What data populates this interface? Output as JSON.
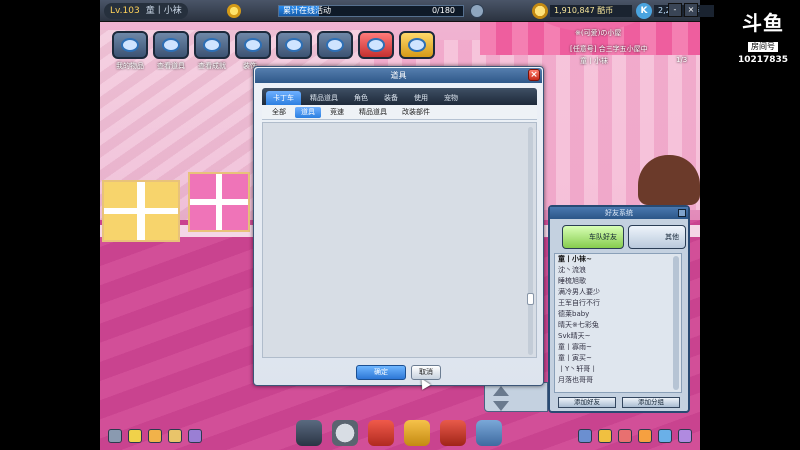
{
  "topbar": {
    "level": "Lv.103",
    "username": "童丨小袜",
    "progress_label": "累计在线活动",
    "progress_value": "0/180",
    "progress_fraction": 0.22,
    "money": "1,910,847 酷币",
    "k_badge": "K",
    "kmoney": "2,238 点券"
  },
  "toolbar": {
    "items": [
      {
        "label": "我的物品",
        "icon": "eye-icon"
      },
      {
        "label": "查看道具",
        "icon": "search-eye-icon"
      },
      {
        "label": "查看成就",
        "icon": "achievement-icon"
      },
      {
        "label": "装饰",
        "icon": "decor-icon"
      },
      {
        "label": "",
        "icon": "photo-icon"
      },
      {
        "label": "",
        "icon": "magnifier-icon"
      },
      {
        "label": "",
        "icon": "room-exit-icon"
      },
      {
        "label": "",
        "icon": "help-icon"
      }
    ]
  },
  "room": {
    "line1": "※(可爱)の小屋",
    "line2": "[任意号] 合三字五小屋中",
    "line3": "童丨小袜",
    "pager": "1/3"
  },
  "dialog": {
    "title": "道具",
    "close": "×",
    "main_tabs": [
      "卡丁车",
      "精品道具",
      "角色",
      "装备",
      "使用",
      "宠物"
    ],
    "main_active": 0,
    "sub_tabs": [
      "全部",
      "道具",
      "竞速",
      "精品道具",
      "改装部件"
    ],
    "sub_active": 1,
    "ok": "确定",
    "cancel": "取消"
  },
  "friends": {
    "title": "好友系统",
    "tab_team": "车队好友",
    "tab_other": "其他",
    "me": "童丨小袜~",
    "list": [
      "沈丶流浪",
      "睡梳旭歌",
      "满冷男人要少",
      "王军自行不行",
      "德莱baby",
      "晴天※七彩兔",
      "Svk晴天~",
      "童丨寡雨~",
      "童丨寅买~",
      "丨Y丶轩哥丨",
      "月落也哥哥"
    ],
    "btn_add": "添加好友",
    "btn_group": "添加分组"
  },
  "douyu": {
    "logo": "斗鱼",
    "room_label": "房间号",
    "room_number": "10217835"
  }
}
